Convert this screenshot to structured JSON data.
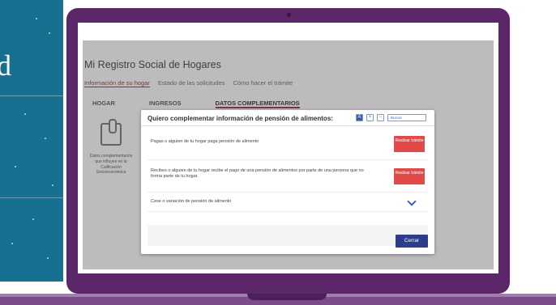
{
  "side_panel": {
    "glyph": "d"
  },
  "app": {
    "title": "Mi Registro Social de Hogares",
    "nav": [
      "Información de su hogar",
      "Estado de las solicitudes",
      "Cómo hacer el trámite"
    ],
    "tabs": [
      "HOGAR",
      "INGRESOS",
      "DATOS COMPLEMENTARIOS"
    ],
    "side_card_caption": "Datos complementarios que influyen en la Calificación Socioeconómica"
  },
  "modal": {
    "title": "Quiero complementar información de pensión de alimentos:",
    "header_buttons": [
      "A",
      "+",
      "−"
    ],
    "search_placeholder": "Buscar",
    "rows": [
      {
        "label": "Pagas o alguien de tu hogar paga pensión de alimento",
        "button": "Realizar trámite"
      },
      {
        "label": "Recibes o alguien de tu hogar recibe el pago de una pensión de alimentos por parte de una persona que no forma parte de tu hogar.",
        "button": "Realizar trámite"
      },
      {
        "label": "Cese o variación de pensión de alimento"
      }
    ],
    "close_button": "Cerrar"
  },
  "colors": {
    "teal_panel": "#17708f",
    "laptop": "#5b2769",
    "red_button": "#e24a4a",
    "close_button": "#2d3d8c",
    "chevron": "#2f63c3"
  }
}
